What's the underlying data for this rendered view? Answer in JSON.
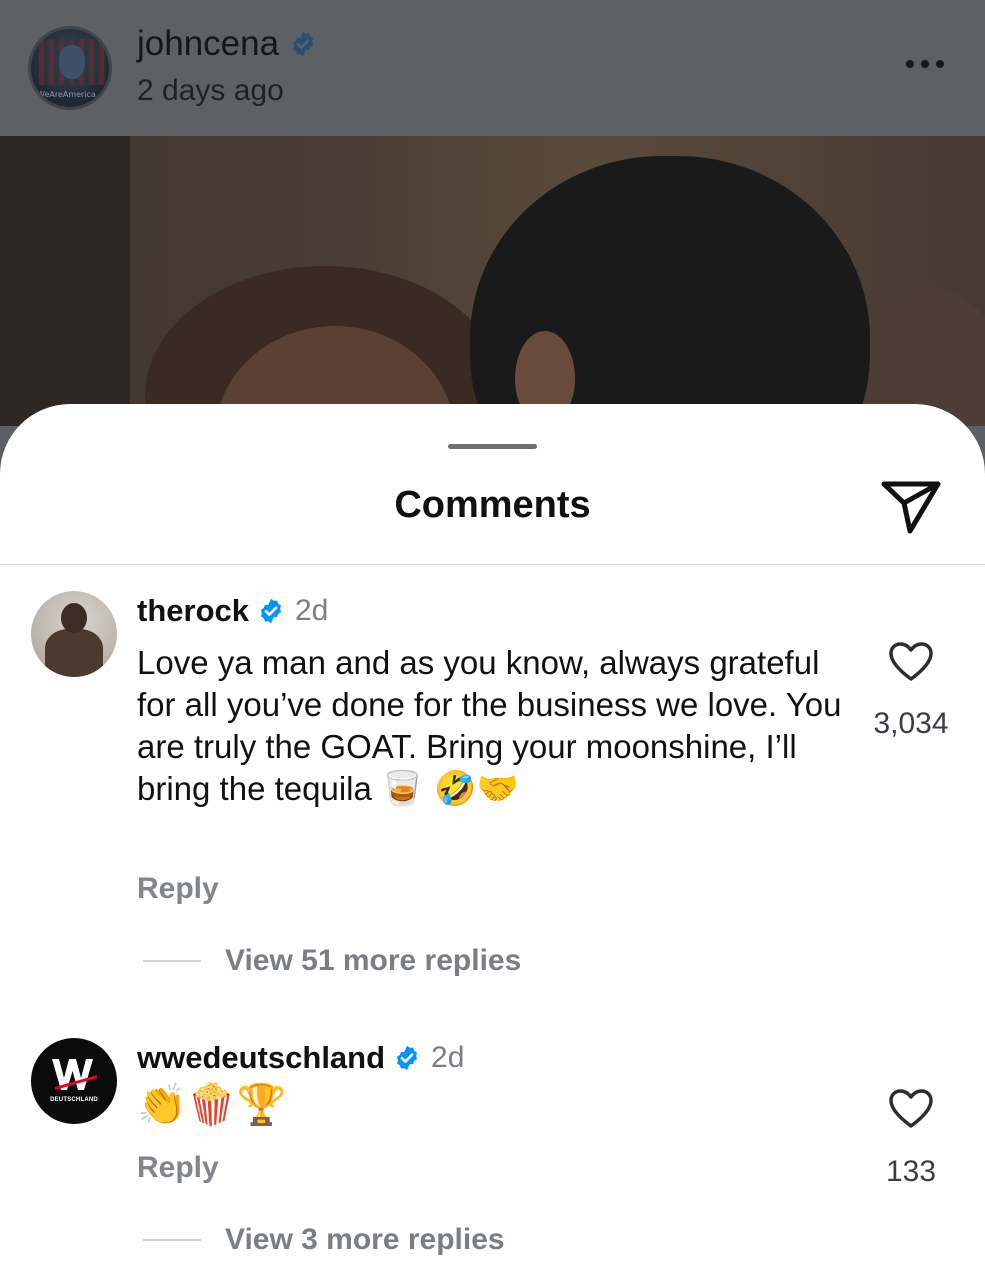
{
  "post": {
    "username": "johncena",
    "time": "2 days ago",
    "avatar_label": "WeAreAmerica"
  },
  "sheet": {
    "title": "Comments"
  },
  "comments": [
    {
      "username": "therock",
      "time": "2d",
      "text": "Love ya man and as you know, always grateful for all you’ve done for the business we love. You are truly the GOAT. Bring your moonshine, I’ll bring the tequila",
      "emoji": "🥃 🤣🤝",
      "likes": "3,034",
      "reply_label": "Reply",
      "view_replies": "View 51 more replies"
    },
    {
      "username": "wwedeutschland",
      "time": "2d",
      "emoji": "👏🍿🏆",
      "avatar_label": "DEUTSCHLAND",
      "likes": "133",
      "reply_label": "Reply",
      "view_replies": "View 3 more replies"
    }
  ],
  "colors": {
    "verified_blue": "#0095f6",
    "dim_overlay": "#5d6166",
    "sheet_bg": "#ffffff"
  },
  "icons": {
    "verified": "verified-badge-icon",
    "more": "more-horizontal-icon",
    "share": "paper-plane-icon",
    "like": "heart-outline-icon"
  }
}
